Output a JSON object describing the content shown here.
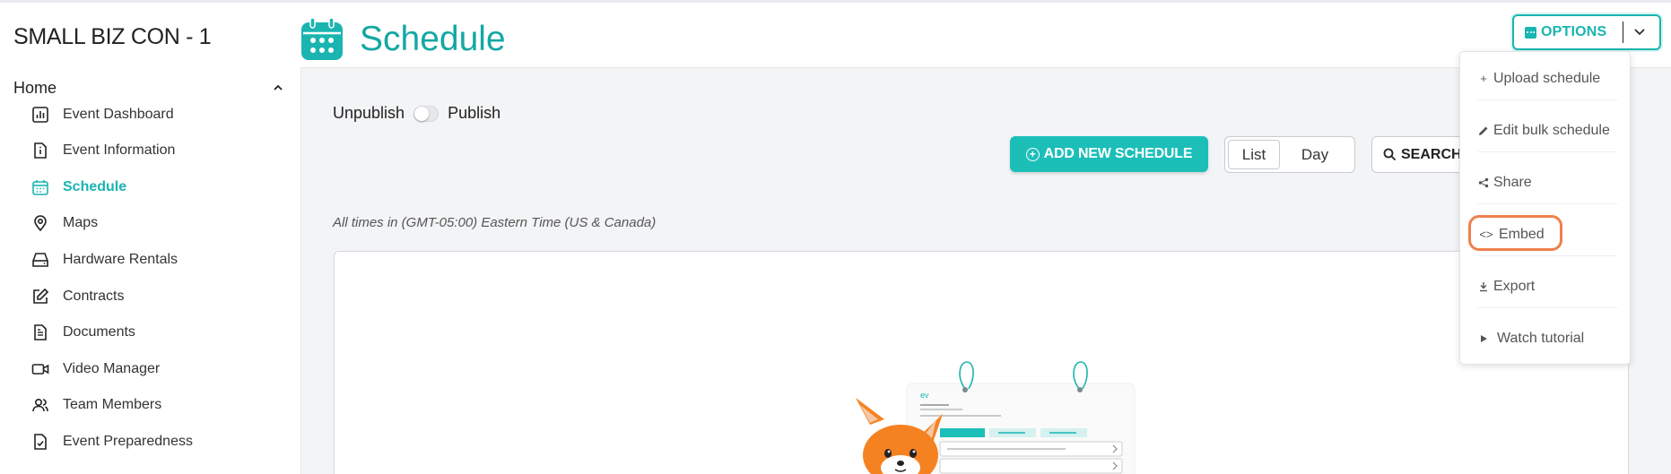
{
  "event_name": "SMALL BIZ CON - 1",
  "sidebar": {
    "section_label": "Home",
    "items": [
      {
        "label": "Event Dashboard",
        "icon": "bar-chart-icon"
      },
      {
        "label": "Event Information",
        "icon": "info-document-icon"
      },
      {
        "label": "Schedule",
        "icon": "calendar-icon",
        "active": true
      },
      {
        "label": "Maps",
        "icon": "map-pin-icon"
      },
      {
        "label": "Hardware Rentals",
        "icon": "hard-drive-icon"
      },
      {
        "label": "Contracts",
        "icon": "edit-square-icon"
      },
      {
        "label": "Documents",
        "icon": "document-icon"
      },
      {
        "label": "Video Manager",
        "icon": "video-camera-icon"
      },
      {
        "label": "Team Members",
        "icon": "users-icon"
      },
      {
        "label": "Event Preparedness",
        "icon": "checklist-document-icon"
      }
    ]
  },
  "header": {
    "title": "Schedule",
    "options_label": "OPTIONS"
  },
  "publish": {
    "unpublish_label": "Unpublish",
    "publish_label": "Publish",
    "state": "unpublished"
  },
  "toolbar": {
    "add_label": "ADD NEW SCHEDULE",
    "view_list": "List",
    "view_day": "Day",
    "search_label": "SEARCH"
  },
  "timezone_note": "All times in (GMT-05:00) Eastern Time (US & Canada)",
  "options_menu": {
    "items": [
      {
        "label": "Upload schedule",
        "icon": "plus-icon"
      },
      {
        "label": "Edit bulk schedule",
        "icon": "pencil-icon"
      },
      {
        "label": "Share",
        "icon": "share-icon"
      },
      {
        "label": "Embed",
        "icon": "code-icon",
        "highlighted": true
      },
      {
        "label": "Export",
        "icon": "download-icon"
      },
      {
        "label": "Watch tutorial",
        "icon": "play-icon"
      }
    ]
  },
  "illustration": {
    "label": "ev"
  },
  "colors": {
    "accent": "#1ab5b0",
    "highlight": "#f07f4c"
  }
}
